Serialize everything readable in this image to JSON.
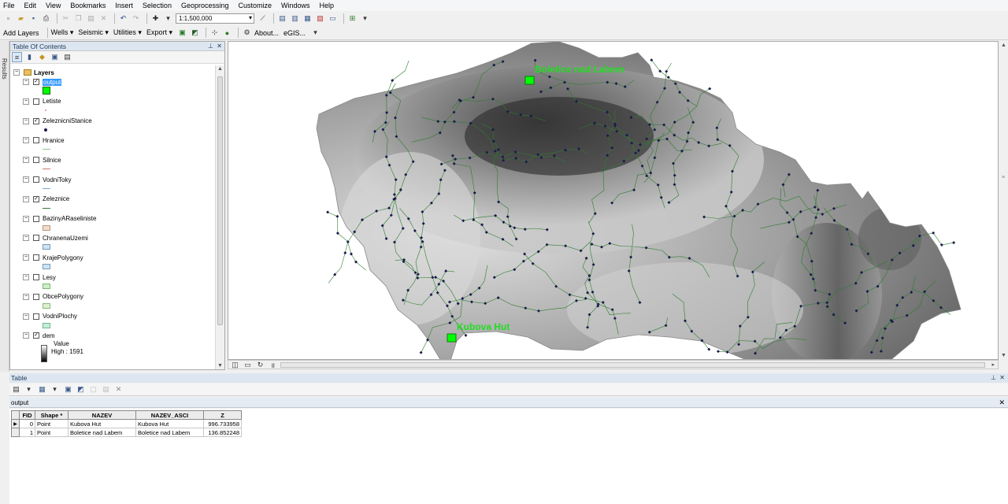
{
  "menu": [
    "File",
    "Edit",
    "View",
    "Bookmarks",
    "Insert",
    "Selection",
    "Geoprocessing",
    "Customize",
    "Windows",
    "Help"
  ],
  "toolbar": {
    "scale": "1:1,500,000"
  },
  "toolbar2": {
    "add_layers": "Add Layers",
    "wells": "Wells ▾",
    "seismic": "Seismic ▾",
    "utilities": "Utilities ▾",
    "export": "Export ▾",
    "about": "About...",
    "egis": "eGIS..."
  },
  "side_tab": "Results",
  "toc": {
    "title": "Table Of Contents",
    "group": "Layers",
    "layers": [
      {
        "name": "output",
        "checked": true,
        "selected": true,
        "symbol": "square-green"
      },
      {
        "name": "Letiste",
        "checked": false,
        "symbol": "dot-pink"
      },
      {
        "name": "ZeleznicniStanice",
        "checked": true,
        "symbol": "dot-navy"
      },
      {
        "name": "Hranice",
        "checked": false,
        "symbol": "line-green"
      },
      {
        "name": "Silnice",
        "checked": false,
        "symbol": "line-red"
      },
      {
        "name": "VodniToky",
        "checked": false,
        "symbol": "line-blue"
      },
      {
        "name": "Zeleznice",
        "checked": true,
        "symbol": "line-darkgreen"
      },
      {
        "name": "BazinyARaseliniste",
        "checked": false,
        "symbol": "rect-peach"
      },
      {
        "name": "ChranenaUzemi",
        "checked": false,
        "symbol": "rect-lightblue"
      },
      {
        "name": "KrajePolygony",
        "checked": false,
        "symbol": "rect-lightblue"
      },
      {
        "name": "Lesy",
        "checked": false,
        "symbol": "rect-lightgreen"
      },
      {
        "name": "ObcePolygony",
        "checked": false,
        "symbol": "rect-palegreen"
      },
      {
        "name": "VodniPlochy",
        "checked": false,
        "symbol": "rect-mint"
      },
      {
        "name": "dem",
        "checked": true,
        "symbol": "ramp"
      }
    ],
    "dem_value_label": "Value",
    "dem_high_label": "High : 1591"
  },
  "map": {
    "labels": [
      {
        "text": "Boletice nad Labem"
      },
      {
        "text": "Kubova Hut"
      }
    ],
    "accent": "#00ff00"
  },
  "table": {
    "title": "Table",
    "tab": "output",
    "columns": [
      "FID",
      "Shape *",
      "NAZEV",
      "NAZEV_ASCI",
      "Z"
    ],
    "rows": [
      [
        "0",
        "Point",
        "Kubova Hut",
        "Kubova Hut",
        "996.733958"
      ],
      [
        "1",
        "Point",
        "Boletice nad Labem",
        "Boletice nad Labem",
        "136.852248"
      ]
    ]
  }
}
